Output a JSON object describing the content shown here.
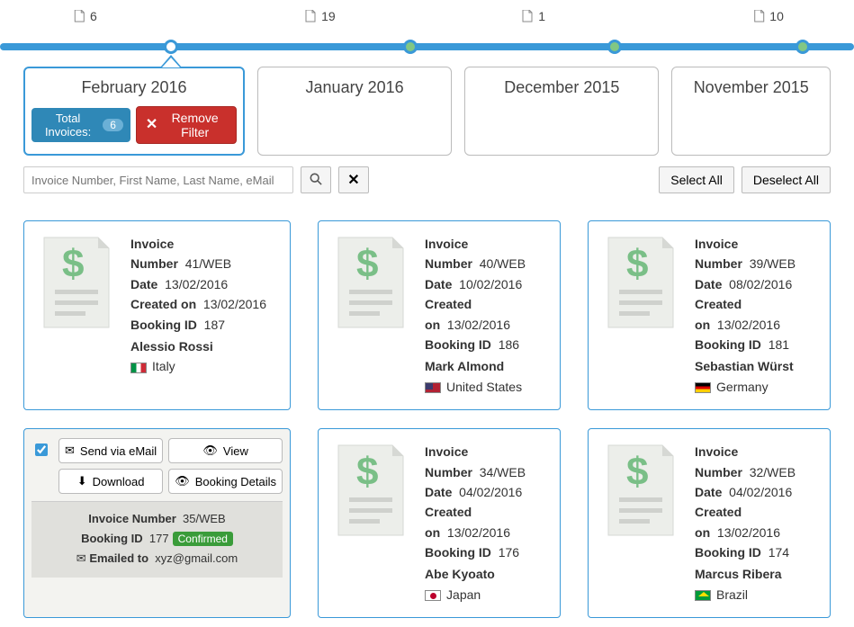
{
  "timeline": {
    "nodes": [
      {
        "count": "6",
        "month": "February 2016",
        "active": true
      },
      {
        "count": "19",
        "month": "January 2016",
        "active": false
      },
      {
        "count": "1",
        "month": "December 2015",
        "active": false
      },
      {
        "count": "10",
        "month": "November 2015",
        "active": false
      }
    ],
    "total_invoices_label": "Total Invoices:",
    "total_invoices_count": "6",
    "remove_filter_label": "Remove Filter"
  },
  "search": {
    "placeholder": "Invoice Number, First Name, Last Name, eMail",
    "select_all": "Select All",
    "deselect_all": "Deselect All"
  },
  "labels": {
    "invoice_number": "Invoice Number",
    "date": "Date",
    "created_on": "Created on",
    "booking_id": "Booking ID",
    "emailed_to": "Emailed to"
  },
  "selected_card": {
    "send_email": "Send via eMail",
    "view": "View",
    "download": "Download",
    "booking_details": "Booking Details",
    "invoice_number": "35/WEB",
    "booking_id": "177",
    "status": "Confirmed",
    "emailed_to": "xyz@gmail.com"
  },
  "cards": [
    {
      "invoice_number": "41/WEB",
      "date": "13/02/2016",
      "created_on": "13/02/2016",
      "booking_id": "187",
      "name": "Alessio Rossi",
      "country": "Italy",
      "flag": "it"
    },
    {
      "invoice_number": "40/WEB",
      "date": "10/02/2016",
      "created_on": "13/02/2016",
      "booking_id": "186",
      "name": "Mark Almond",
      "country": "United States",
      "flag": "us"
    },
    {
      "invoice_number": "39/WEB",
      "date": "08/02/2016",
      "created_on": "13/02/2016",
      "booking_id": "181",
      "name": "Sebastian Würst",
      "country": "Germany",
      "flag": "de"
    },
    {
      "selected": true
    },
    {
      "invoice_number": "34/WEB",
      "date": "04/02/2016",
      "created_on": "13/02/2016",
      "booking_id": "176",
      "name": "Abe Kyoato",
      "country": "Japan",
      "flag": "jp"
    },
    {
      "invoice_number": "32/WEB",
      "date": "04/02/2016",
      "created_on": "13/02/2016",
      "booking_id": "174",
      "name": "Marcus Ribera",
      "country": "Brazil",
      "flag": "br"
    }
  ]
}
